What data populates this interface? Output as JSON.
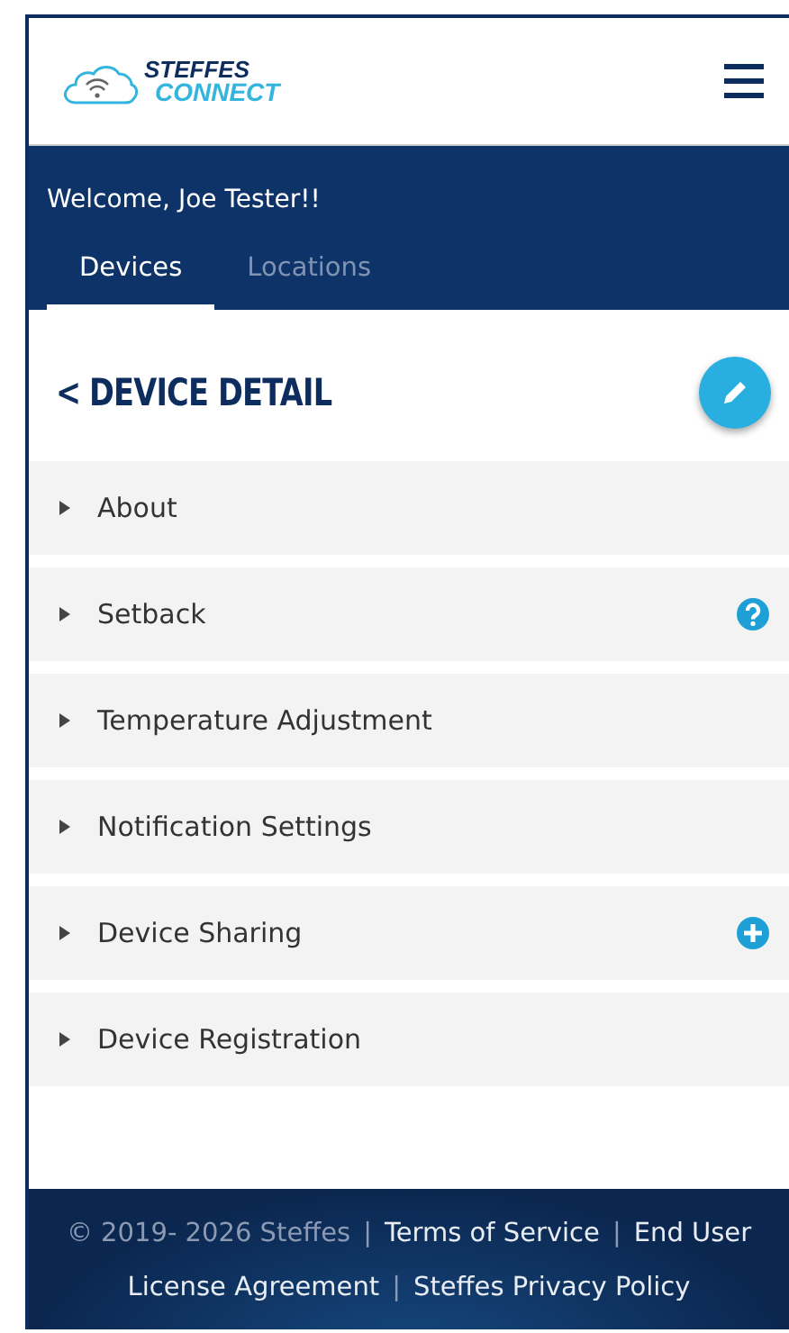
{
  "header": {
    "logo_line_1": "STEFFES",
    "logo_line_2": "CONNECT"
  },
  "welcome": "Welcome, Joe Tester!!",
  "tabs": [
    {
      "label": "Devices",
      "selected": true
    },
    {
      "label": "Locations",
      "selected": false
    }
  ],
  "page_title": {
    "back": "<",
    "title": "DEVICE DETAIL"
  },
  "sections": [
    {
      "label": "About",
      "expanded": false,
      "kind": "plain"
    },
    {
      "label": "Setback",
      "expanded": false,
      "kind": "help"
    },
    {
      "label": "Temperature Adjustment",
      "expanded": false,
      "kind": "plain"
    },
    {
      "label": "Notification Settings",
      "expanded": false,
      "kind": "plain"
    },
    {
      "label": "Device Sharing",
      "expanded": false,
      "kind": "add"
    },
    {
      "label": "Device Registration",
      "expanded": false,
      "kind": "plain"
    }
  ],
  "footer": [
    {
      "kind": "text",
      "text": "© 2019- 2026 Steffes"
    },
    {
      "kind": "sep",
      "text": "|"
    },
    {
      "kind": "link",
      "text": "Terms of Service"
    },
    {
      "kind": "sep",
      "text": "|"
    },
    {
      "kind": "link",
      "text": "End User"
    },
    {
      "kind": "link",
      "text": "License Agreement"
    },
    {
      "kind": "sep",
      "text": "|"
    },
    {
      "kind": "link",
      "text": "Steffes Privacy Policy"
    }
  ]
}
